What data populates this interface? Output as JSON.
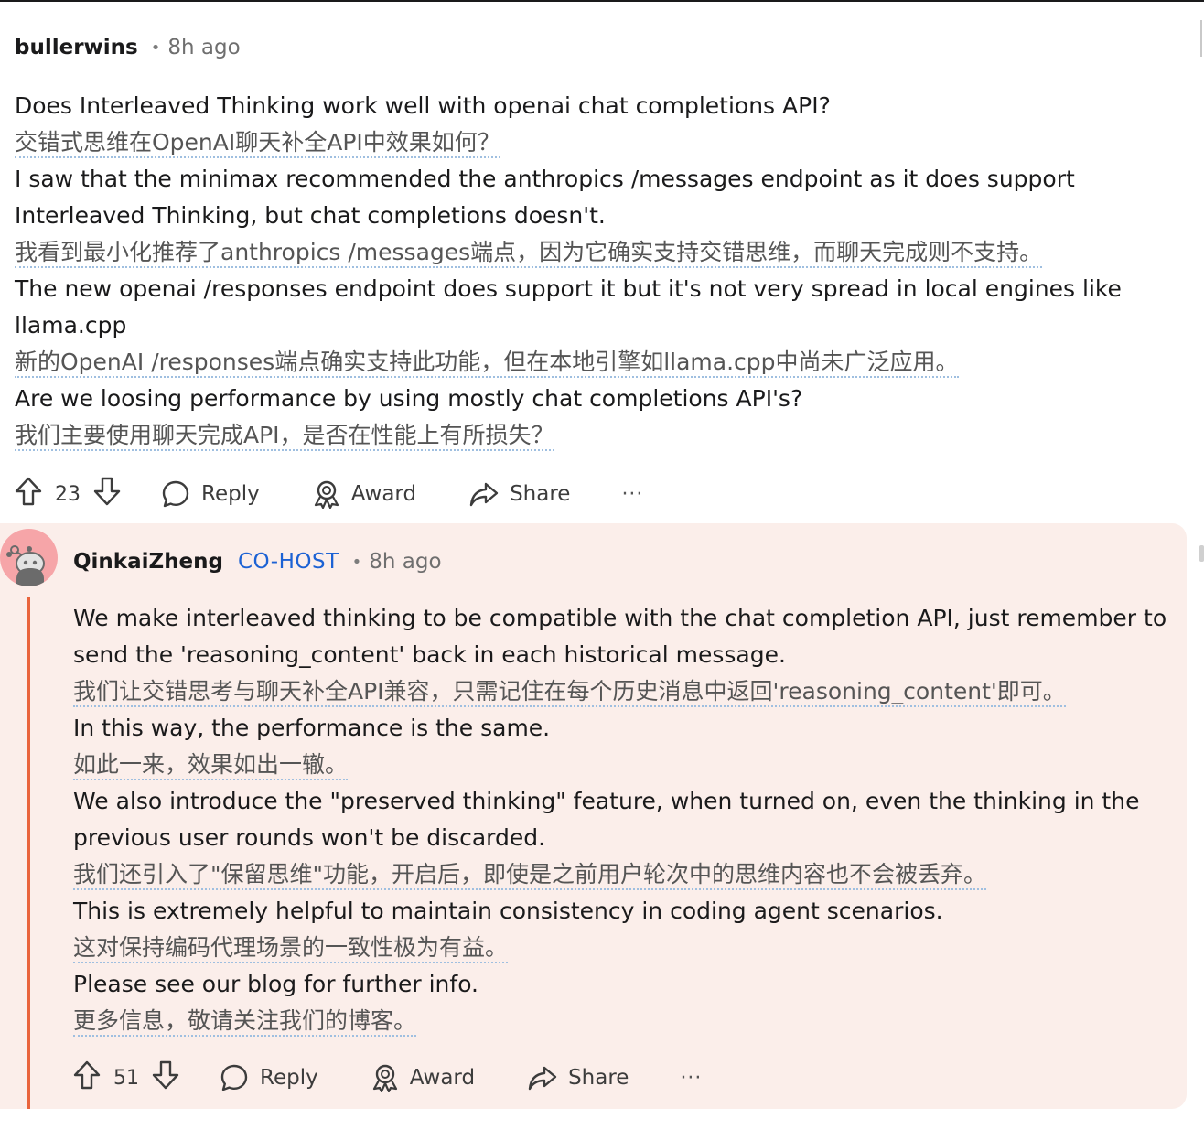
{
  "comment1": {
    "author": "bullerwins",
    "time": "8h ago",
    "lines": [
      {
        "text": "Does Interleaved Thinking work well with openai chat completions API?",
        "tr": false
      },
      {
        "text": "交错式思维在OpenAI聊天补全API中效果如何？",
        "tr": true
      },
      {
        "text": "I saw that the minimax recommended the anthropics /messages endpoint as it does support",
        "tr": false
      },
      {
        "text": "Interleaved Thinking, but chat completions doesn't.",
        "tr": false
      },
      {
        "text": "我看到最小化推荐了anthropics /messages端点，因为它确实支持交错思维，而聊天完成则不支持。",
        "tr": true
      },
      {
        "text": "The new openai /responses endpoint does support it but it's not very spread in local engines like",
        "tr": false
      },
      {
        "text": "llama.cpp",
        "tr": false
      },
      {
        "text": "新的OpenAI /responses端点确实支持此功能，但在本地引擎如llama.cpp中尚未广泛应用。",
        "tr": true
      },
      {
        "text": "Are we loosing performance by using mostly chat completions API's?",
        "tr": false
      },
      {
        "text": "我们主要使用聊天完成API，是否在性能上有所损失？",
        "tr": true
      }
    ],
    "actions": {
      "votes": "23",
      "reply": "Reply",
      "award": "Award",
      "share": "Share",
      "more": "···"
    }
  },
  "comment2": {
    "author": "QinkaiZheng",
    "badge": "CO-HOST",
    "time": "8h ago",
    "lines": [
      {
        "text": "We make interleaved thinking to be compatible with the chat completion API, just remember to",
        "tr": false
      },
      {
        "text": "send the 'reasoning_content' back in each historical message.",
        "tr": false
      },
      {
        "text": "我们让交错思考与聊天补全API兼容，只需记住在每个历史消息中返回'reasoning_content'即可。",
        "tr": true
      },
      {
        "text": "In this way, the performance is the same.",
        "tr": false
      },
      {
        "text": "如此一来，效果如出一辙。",
        "tr": true
      },
      {
        "text": "We also introduce the \"preserved thinking\" feature, when turned on, even the thinking in the",
        "tr": false
      },
      {
        "text": "previous user rounds won't be discarded.",
        "tr": false
      },
      {
        "text": "我们还引入了\"保留思维\"功能，开启后，即使是之前用户轮次中的思维内容也不会被丢弃。",
        "tr": true
      },
      {
        "text": "This is extremely helpful to maintain consistency in coding agent scenarios.",
        "tr": false
      },
      {
        "text": "这对保持编码代理场景的一致性极为有益。",
        "tr": true
      },
      {
        "text": "Please see our blog for further info.",
        "tr": false
      },
      {
        "text": "更多信息，敬请关注我们的博客。",
        "tr": true
      }
    ],
    "actions": {
      "votes": "51",
      "reply": "Reply",
      "award": "Award",
      "share": "Share",
      "more": "···"
    }
  },
  "colors": {
    "accent_thread": "#e9643c",
    "cohost": "#1c62d4",
    "highlight_bg": "#fbeeea",
    "avatar_bg": "#f6a5a8"
  },
  "icons": [
    "upvote-icon",
    "downvote-icon",
    "reply-bubble-icon",
    "award-icon",
    "share-icon",
    "more-icon",
    "snoo-avatar-icon"
  ]
}
